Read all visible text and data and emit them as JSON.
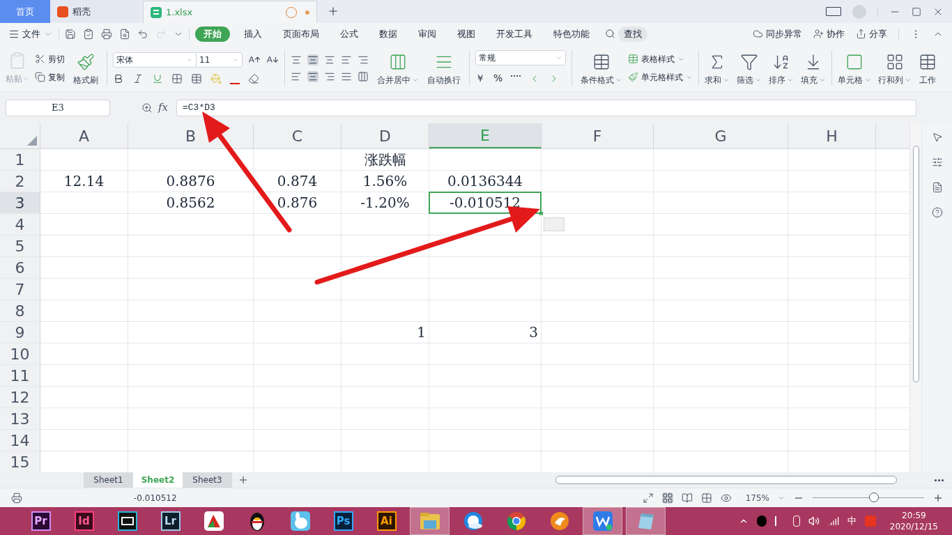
{
  "tabs": [
    {
      "label": "首页",
      "selected": false,
      "kind": "home"
    },
    {
      "label": "稻壳",
      "selected": false,
      "kind": "docer"
    },
    {
      "label": "1.xlsx",
      "selected": true,
      "kind": "sheet",
      "modified": true
    }
  ],
  "menu": {
    "file": "文件",
    "items": [
      {
        "label": "开始",
        "selected": true
      },
      {
        "label": "插入",
        "selected": false
      },
      {
        "label": "页面布局",
        "selected": false
      },
      {
        "label": "公式",
        "selected": false
      },
      {
        "label": "数据",
        "selected": false
      },
      {
        "label": "审阅",
        "selected": false
      },
      {
        "label": "视图",
        "selected": false
      },
      {
        "label": "开发工具",
        "selected": false
      },
      {
        "label": "特色功能",
        "selected": false
      }
    ],
    "search": "查找",
    "sync": "同步异常",
    "collab": "协作",
    "share": "分享"
  },
  "ribbon": {
    "paste": {
      "label": "粘贴",
      "disabled": true
    },
    "cut": "剪切",
    "copy": "复制",
    "format_painter": "格式刷",
    "font": "宋体",
    "font_size": "11",
    "merge": "合并居中",
    "wrap": "自动换行",
    "number_format": "常规",
    "currency": "￥",
    "percent": "%",
    "conditional": "条件格式",
    "table_style": "表格样式",
    "cell_style": "单元格样式",
    "sum": "求和",
    "filter": "筛选",
    "sort": "排序",
    "fill": "填充",
    "cells": "单元格",
    "rows_cols": "行和列",
    "sheet": "工作"
  },
  "name_box": "E3",
  "fx": "fx",
  "formula": "=C3*D3",
  "columns": [
    {
      "label": "A",
      "selected": false
    },
    {
      "label": "B",
      "selected": false
    },
    {
      "label": "C",
      "selected": false
    },
    {
      "label": "D",
      "selected": false
    },
    {
      "label": "E",
      "selected": true
    },
    {
      "label": "F",
      "selected": false
    },
    {
      "label": "G",
      "selected": false
    },
    {
      "label": "H",
      "selected": false
    }
  ],
  "rows": [
    {
      "label": "1",
      "selected": false,
      "cells": [
        null,
        null,
        null,
        {
          "text": "涨跌幅"
        },
        null,
        null,
        null,
        null
      ]
    },
    {
      "label": "2",
      "selected": false,
      "cells": [
        {
          "text": "12.14"
        },
        {
          "text": "0.8876"
        },
        {
          "text": "0.874"
        },
        {
          "text": "1.56%"
        },
        {
          "text": "0.0136344"
        },
        null,
        null,
        null
      ]
    },
    {
      "label": "3",
      "selected": true,
      "cells": [
        null,
        {
          "text": "0.8562"
        },
        {
          "text": "0.876"
        },
        {
          "text": "-1.20%"
        },
        {
          "text": "-0.010512"
        },
        null,
        null,
        null
      ]
    },
    {
      "label": "4",
      "selected": false,
      "cells": [
        null,
        null,
        null,
        null,
        null,
        null,
        null,
        null
      ]
    },
    {
      "label": "5",
      "selected": false,
      "cells": [
        null,
        null,
        null,
        null,
        null,
        null,
        null,
        null
      ]
    },
    {
      "label": "6",
      "selected": false,
      "cells": [
        null,
        null,
        null,
        null,
        null,
        null,
        null,
        null
      ]
    },
    {
      "label": "7",
      "selected": false,
      "cells": [
        null,
        null,
        null,
        null,
        null,
        null,
        null,
        null
      ]
    },
    {
      "label": "8",
      "selected": false,
      "cells": [
        null,
        null,
        null,
        null,
        null,
        null,
        null,
        null
      ]
    },
    {
      "label": "9",
      "selected": false,
      "cells": [
        null,
        null,
        null,
        {
          "text": "1",
          "right_aligned": true
        },
        {
          "text": "3",
          "right_aligned": true
        },
        null,
        null,
        null
      ]
    },
    {
      "label": "10",
      "selected": false,
      "cells": [
        null,
        null,
        null,
        null,
        null,
        null,
        null,
        null
      ]
    },
    {
      "label": "11",
      "selected": false,
      "cells": [
        null,
        null,
        null,
        null,
        null,
        null,
        null,
        null
      ]
    },
    {
      "label": "12",
      "selected": false,
      "cells": [
        null,
        null,
        null,
        null,
        null,
        null,
        null,
        null
      ]
    },
    {
      "label": "13",
      "selected": false,
      "cells": [
        null,
        null,
        null,
        null,
        null,
        null,
        null,
        null
      ]
    },
    {
      "label": "14",
      "selected": false,
      "cells": [
        null,
        null,
        null,
        null,
        null,
        null,
        null,
        null
      ]
    },
    {
      "label": "15",
      "selected": false,
      "cells": [
        null,
        null,
        null,
        null,
        null,
        null,
        null,
        null
      ]
    }
  ],
  "sheets": [
    {
      "label": "Sheet1",
      "selected": false
    },
    {
      "label": "Sheet2",
      "selected": true
    },
    {
      "label": "Sheet3",
      "selected": false
    }
  ],
  "status": {
    "value": "-0.010512",
    "zoom": "175%",
    "level": 0.55
  },
  "taskbar": {
    "apps": [
      {
        "kind": "pr",
        "label": "Pr",
        "running": false
      },
      {
        "kind": "id",
        "label": "Id",
        "running": false
      },
      {
        "kind": "film",
        "running": false
      },
      {
        "kind": "lr",
        "label": "Lr",
        "running": false
      },
      {
        "kind": "chart",
        "running": false
      },
      {
        "kind": "penguin",
        "running": false
      },
      {
        "kind": "bunny",
        "running": false
      },
      {
        "kind": "ps",
        "label": "Ps",
        "running": false
      },
      {
        "kind": "ai",
        "label": "Ai",
        "running": false
      },
      {
        "kind": "folder",
        "running": true
      },
      {
        "kind": "browser",
        "running": false
      },
      {
        "kind": "chrome",
        "running": false
      },
      {
        "kind": "fox",
        "running": false
      },
      {
        "kind": "wps",
        "running": true
      },
      {
        "kind": "notepad",
        "running": true
      }
    ],
    "ime": "中",
    "time": "20:59",
    "date": "2020/12/15"
  }
}
